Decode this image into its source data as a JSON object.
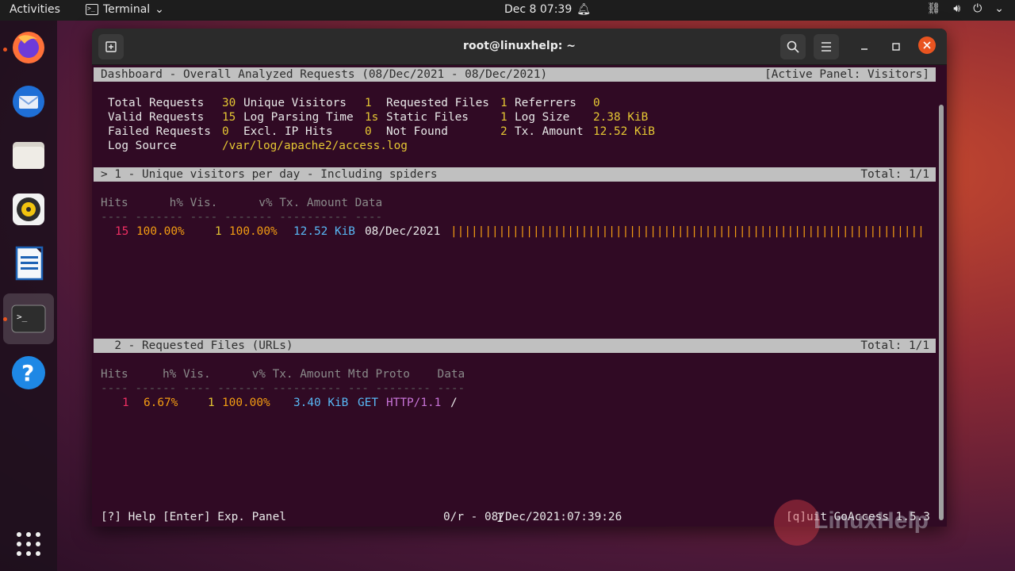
{
  "topbar": {
    "activities": "Activities",
    "app_name": "Terminal",
    "clock": "Dec 8  07:39",
    "tray_icons": [
      "network-icon",
      "volume-icon",
      "power-icon"
    ]
  },
  "dock": {
    "items": [
      "firefox",
      "thunderbird",
      "files",
      "rhythmbox",
      "libreoffice-writer",
      "terminal",
      "help"
    ],
    "grid": "show-applications"
  },
  "window": {
    "title": "root@linuxhelp: ~"
  },
  "goaccess": {
    "header_left": "Dashboard - Overall Analyzed Requests (08/Dec/2021 - 08/Dec/2021)",
    "header_right": "[Active Panel: Visitors]",
    "overview": {
      "total_requests_label": "Total Requests",
      "total_requests": "30",
      "unique_visitors_label": "Unique Visitors",
      "unique_visitors": "1",
      "requested_files_label": "Requested Files",
      "requested_files": "1",
      "referrers_label": "Referrers",
      "referrers": "0",
      "valid_requests_label": "Valid Requests",
      "valid_requests": "15",
      "log_parsing_time_label": "Log Parsing Time",
      "log_parsing_time": "1s",
      "static_files_label": "Static Files",
      "static_files": "1",
      "log_size_label": "Log Size",
      "log_size": "2.38 KiB",
      "failed_requests_label": "Failed Requests",
      "failed_requests": "0",
      "excl_ip_hits_label": "Excl. IP Hits",
      "excl_ip_hits": "0",
      "not_found_label": "Not Found",
      "not_found": "2",
      "tx_amount_label": "Tx. Amount",
      "tx_amount": "12.52 KiB",
      "log_source_label": "Log Source",
      "log_source": "/var/log/apache2/access.log"
    },
    "panel1": {
      "title": "> 1 - Unique visitors per day - Including spiders",
      "total": "Total: 1/1",
      "columns": "Hits      h% Vis.      v% Tx. Amount Data",
      "divider": "---- ------- ---- ------- ---------- ----",
      "row": {
        "hits": "15",
        "h_pct": "100.00%",
        "vis": "1",
        "v_pct": "100.00%",
        "tx_amount": "12.52 KiB",
        "data": "08/Dec/2021",
        "bar": "|||||||||||||||||||||||||||||||||||||||||||||||||||||||||||||||||||||"
      }
    },
    "panel2": {
      "title": "  2 - Requested Files (URLs)",
      "total": "Total: 1/1",
      "columns": "Hits     h% Vis.      v% Tx. Amount Mtd Proto    Data",
      "divider": "---- ------ ---- ------- ---------- --- -------- ----",
      "row": {
        "hits": "1",
        "h_pct": "6.67%",
        "vis": "1",
        "v_pct": "100.00%",
        "tx_amount": "3.40 KiB",
        "method": "GET",
        "proto": "HTTP/1.1",
        "data": "/"
      }
    },
    "footer": {
      "help": "[?] Help [Enter] Exp. Panel",
      "timestamp": "0/r - 08/Dec/2021:07:39:26",
      "quit": "[q]uit GoAccess 1.5.3"
    }
  },
  "watermark": "LinuxHelp",
  "colors": {
    "terminal_bg": "#300a24",
    "accent": "#e95420",
    "hits": "#ef2f63",
    "percent": "#f39c12",
    "amount": "#58b8f5",
    "proto": "#c773d6"
  }
}
